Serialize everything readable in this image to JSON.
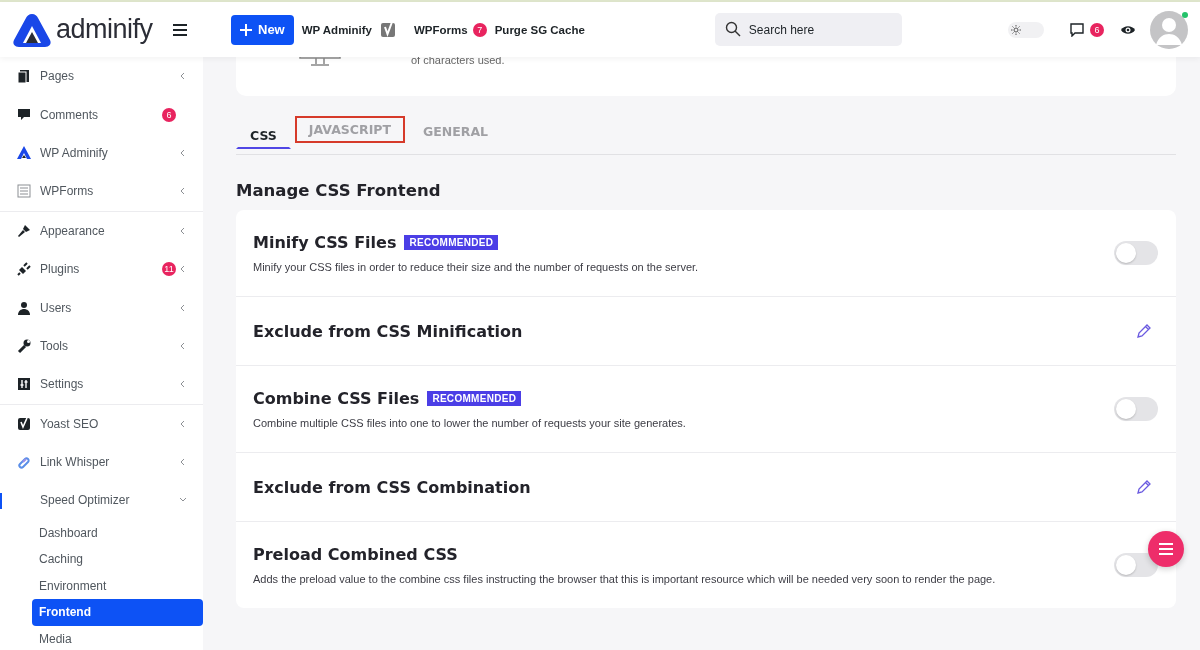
{
  "topbar": {
    "brand": "adminify",
    "new_button": "New",
    "links": [
      {
        "label": "WP Adminify"
      },
      {
        "label": "WPForms",
        "badge": "7"
      },
      {
        "label": "Purge SG Cache"
      }
    ],
    "search": {
      "placeholder": "Search here"
    },
    "theme_toggle": {
      "on": false
    },
    "comments_badge": "6",
    "avatar_online": true
  },
  "sidebar": {
    "items": [
      {
        "label": "Pages"
      },
      {
        "label": "Comments",
        "badge": "6"
      },
      {
        "label": "WP Adminify"
      },
      {
        "label": "WPForms"
      },
      {
        "label": "Appearance"
      },
      {
        "label": "Plugins",
        "badge": "11"
      },
      {
        "label": "Users"
      },
      {
        "label": "Tools"
      },
      {
        "label": "Settings"
      },
      {
        "label": "Yoast SEO"
      },
      {
        "label": "Link Whisper"
      },
      {
        "label": "Speed Optimizer",
        "expanded": true,
        "children": [
          {
            "label": "Dashboard",
            "selected": false
          },
          {
            "label": "Caching",
            "selected": false
          },
          {
            "label": "Environment",
            "selected": false
          },
          {
            "label": "Frontend",
            "selected": true
          },
          {
            "label": "Media",
            "selected": false
          }
        ]
      }
    ]
  },
  "intro_card": {
    "text": "of characters used."
  },
  "tabs": [
    {
      "label": "CSS",
      "selected": true,
      "outlined": false
    },
    {
      "label": "JAVASCRIPT",
      "selected": false,
      "outlined": true
    },
    {
      "label": "GENERAL",
      "selected": false,
      "outlined": false
    }
  ],
  "section_title": "Manage CSS Frontend",
  "options": [
    {
      "kind": "toggle",
      "title": "Minify CSS Files",
      "tag": "RECOMMENDED",
      "description": "Minify your CSS files in order to reduce their size and the number of requests on the server.",
      "on": false
    },
    {
      "kind": "edit",
      "title": "Exclude from CSS Minification"
    },
    {
      "kind": "toggle",
      "title": "Combine CSS Files",
      "tag": "RECOMMENDED",
      "description": "Combine multiple CSS files into one to lower the number of requests your site generates.",
      "on": false
    },
    {
      "kind": "edit",
      "title": "Exclude from CSS Combination"
    },
    {
      "kind": "toggle",
      "title": "Preload Combined CSS",
      "description": "Adds the preload value to the combine css files instructing the browser that this is important resource which will be needed very soon to render the page.",
      "on": false
    }
  ]
}
